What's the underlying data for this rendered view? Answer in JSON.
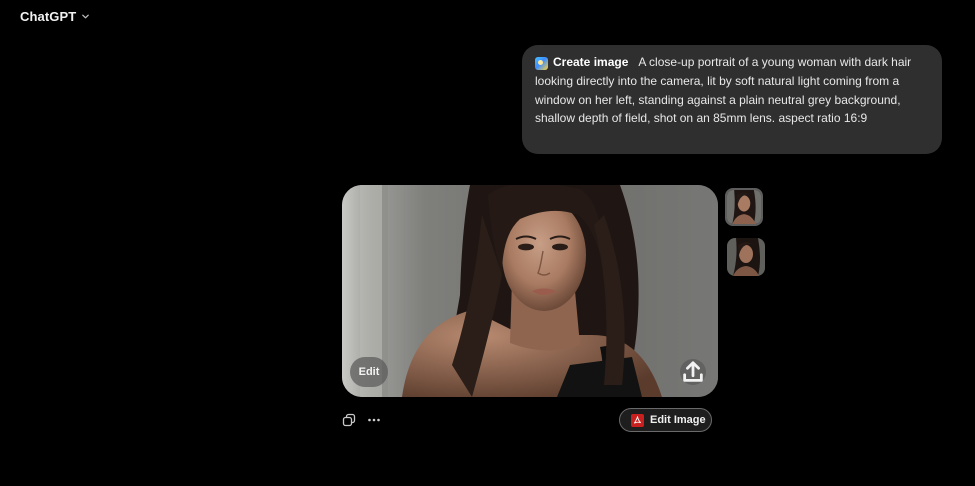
{
  "header": {
    "model_name": "ChatGPT",
    "chevron_icon": "chevron-down-icon"
  },
  "user_message": {
    "tool_label": "Create image",
    "tool_icon": "create-image-icon",
    "prompt_text": "A close-up portrait of a young woman with dark hair looking directly into the camera, lit by soft natural light coming from a window on her left, standing against a plain neutral grey background, shallow depth of field, shot on an 85mm lens. aspect ratio 16:9"
  },
  "generated_image": {
    "edit_label": "Edit",
    "share_icon": "share-upload-icon"
  },
  "thumbnails": {
    "selected_index": 0,
    "count": 2
  },
  "actions": {
    "copy_icon": "copy-icon",
    "more_icon": "more-dots-icon",
    "edit_image_label": "Edit Image",
    "edit_image_icon": "pdf-acrobat-icon"
  },
  "colors": {
    "background": "#000000",
    "bubble": "#2f2f2f",
    "accent_pdf": "#c8201f"
  }
}
